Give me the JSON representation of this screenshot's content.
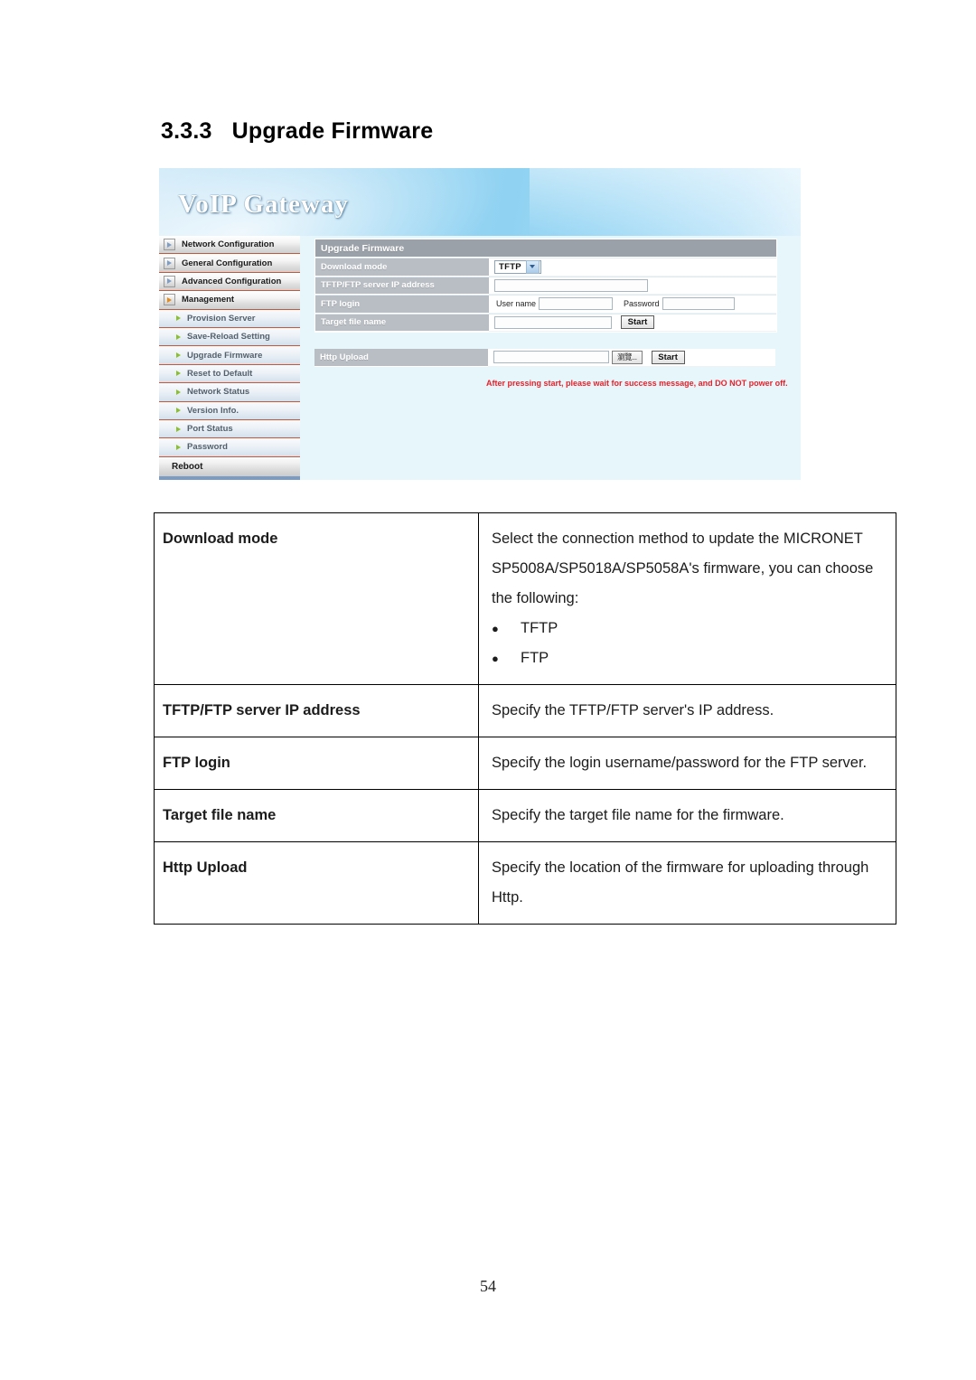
{
  "heading": {
    "number": "3.3.3",
    "title": "Upgrade Firmware"
  },
  "screenshot": {
    "banner_title": "VoIP Gateway",
    "sidebar": {
      "top_items": [
        {
          "label": "Network Configuration",
          "active": false
        },
        {
          "label": "General Configuration",
          "active": false
        },
        {
          "label": "Advanced Configuration",
          "active": false
        },
        {
          "label": "Management",
          "active": true
        }
      ],
      "sub_items": [
        {
          "label": "Provision Server"
        },
        {
          "label": "Save-Reload Setting"
        },
        {
          "label": "Upgrade Firmware"
        },
        {
          "label": "Reset to Default"
        },
        {
          "label": "Network Status"
        },
        {
          "label": "Version Info."
        },
        {
          "label": "Port Status"
        },
        {
          "label": "Password"
        }
      ],
      "reboot_label": "Reboot"
    },
    "panel": {
      "header": "Upgrade Firmware",
      "rows": {
        "download_mode_label": "Download mode",
        "download_mode_value": "TFTP",
        "server_ip_label": "TFTP/FTP server IP address",
        "server_ip_value": "",
        "ftp_login_label": "FTP login",
        "user_name_label": "User name",
        "user_name_value": "",
        "password_label": "Password",
        "password_value": "",
        "target_file_label": "Target file name",
        "target_file_value": "",
        "target_start_button": "Start",
        "http_upload_label": "Http Upload",
        "http_upload_value": "",
        "http_browse_button": "瀏覽...",
        "http_start_button": "Start"
      },
      "warning": "After pressing start, please wait for success message, and DO NOT power off."
    }
  },
  "description_table": {
    "rows": [
      {
        "key": "Download mode",
        "value_lines": [
          "Select the connection method to update the MICRONET",
          "SP5008A/SP5018A/SP5058A's firmware, you can choose",
          "the following:"
        ],
        "bullets": [
          "TFTP",
          "FTP"
        ]
      },
      {
        "key": "TFTP/FTP server IP address",
        "value_lines": [
          "Specify the TFTP/FTP server's IP address."
        ],
        "bullets": []
      },
      {
        "key": "FTP login",
        "value_lines": [
          "Specify the login username/password for the FTP server."
        ],
        "bullets": []
      },
      {
        "key": "Target file name",
        "value_lines": [
          "Specify the target file name for the firmware."
        ],
        "bullets": []
      },
      {
        "key": "Http Upload",
        "value_lines": [
          "Specify the location of the firmware for uploading through",
          "Http."
        ],
        "bullets": []
      }
    ]
  },
  "page_number": "54",
  "colors": {
    "label_cell": "#b9bec4",
    "panel_bg": "#e7f6fb",
    "warning_text": "#e8212a",
    "active_arrow": "#e58a17"
  }
}
